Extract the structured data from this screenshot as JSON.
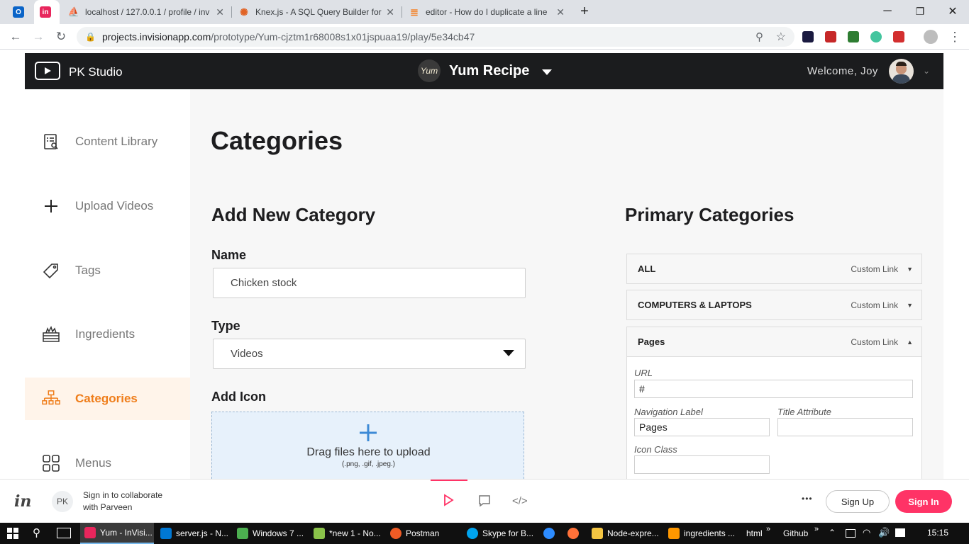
{
  "browser": {
    "tabs": [
      {
        "title": "",
        "favicon_color": "#0a64c8"
      },
      {
        "title": "",
        "favicon_color": "#e8265c",
        "active": true
      },
      {
        "title": "localhost / 127.0.0.1 / profile / inv",
        "favicon_color": "#f29111"
      },
      {
        "title": "Knex.js - A SQL Query Builder for",
        "favicon_color": "#e16426"
      },
      {
        "title": "editor - How do I duplicate a line",
        "favicon_color": "#f48024"
      }
    ],
    "new_tab": "+",
    "url_host": "projects.invisionapp.com",
    "url_path": "/prototype/Yum-cjztm1r68008s1x01jspuaa19/play/5e34cb47"
  },
  "app": {
    "studio_name": "PK Studio",
    "project_name": "Yum Recipe",
    "project_logo_text": "Yum",
    "welcome": "Welcome, Joy"
  },
  "sidebar": {
    "items": [
      {
        "label": "Content Library",
        "icon": "content-library-icon"
      },
      {
        "label": "Upload Videos",
        "icon": "plus-icon"
      },
      {
        "label": "Tags",
        "icon": "tag-icon"
      },
      {
        "label": "Ingredients",
        "icon": "ingredients-icon"
      },
      {
        "label": "Categories",
        "icon": "categories-icon",
        "active": true
      },
      {
        "label": "Menus",
        "icon": "grid-icon"
      }
    ]
  },
  "main": {
    "page_title": "Categories",
    "add_section_title": "Add New Category",
    "name_label": "Name",
    "name_value": "Chicken stock",
    "type_label": "Type",
    "type_value": "Videos",
    "icon_label": "Add Icon",
    "upload_text": "Drag files here to upload",
    "upload_formats": "(.png, .gif, .jpeg.)",
    "primary_title": "Primary Categories",
    "categories": [
      {
        "name": "ALL",
        "type": "Custom Link",
        "expanded": false
      },
      {
        "name": "COMPUTERS & LAPTOPS",
        "type": "Custom Link",
        "expanded": false
      },
      {
        "name": "Pages",
        "type": "Custom Link",
        "expanded": true
      }
    ],
    "detail": {
      "url_label": "URL",
      "url_value": "#",
      "nav_label": "Navigation Label",
      "nav_value": "Pages",
      "title_attr_label": "Title Attribute",
      "title_attr_value": "",
      "icon_class_label": "Icon Class",
      "icon_class_value": ""
    }
  },
  "invision_bar": {
    "avatar_initials": "PK",
    "signin_line1": "Sign in to collaborate",
    "signin_line2": "with Parveen",
    "more": "•••",
    "sign_up": "Sign Up",
    "sign_in": "Sign In",
    "brand_accent": "#ff3366"
  },
  "taskbar": {
    "items": [
      {
        "label": "Yum - InVisi...",
        "color": "#e8265c",
        "active": true
      },
      {
        "label": "server.js - N...",
        "color": "#0078d4"
      },
      {
        "label": "Windows 7 ...",
        "color": "#4caf50"
      },
      {
        "label": "*new 1 - No...",
        "color": "#8bc34a"
      },
      {
        "label": "Postman",
        "color": "#ef5b25"
      },
      {
        "label": "Skype for B...",
        "color": "#00a4ef"
      },
      {
        "label": "",
        "color": "#2d8cff"
      },
      {
        "label": "",
        "color": "#ff7139"
      },
      {
        "label": "Node-expre...",
        "color": "#f4c542"
      },
      {
        "label": "ingredients ...",
        "color": "#ff9800"
      }
    ],
    "toolbars": [
      "html",
      "Github"
    ],
    "time": "15:15"
  }
}
